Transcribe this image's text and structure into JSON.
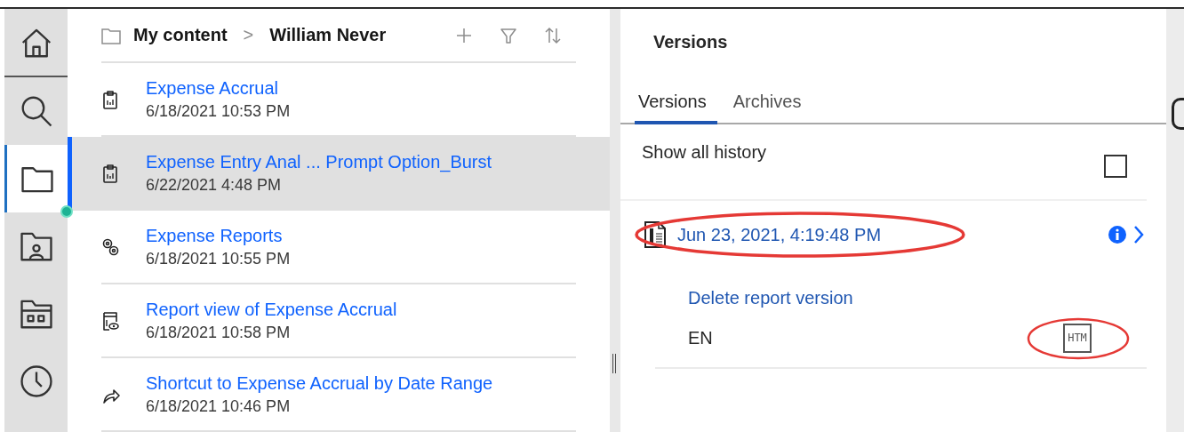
{
  "sidebar": {
    "items": [
      {
        "kind": "home",
        "selected": false
      },
      {
        "kind": "search",
        "selected": false
      },
      {
        "kind": "folder",
        "selected": true,
        "badge": true
      },
      {
        "kind": "team_folder",
        "selected": false
      },
      {
        "kind": "content_folder",
        "selected": false
      },
      {
        "kind": "recent",
        "selected": false
      }
    ]
  },
  "content": {
    "breadcrumb": [
      "My content",
      "William Never"
    ],
    "separator": ">",
    "items": [
      {
        "kind": "report",
        "title": "Expense Accrual",
        "date": "6/18/2021 10:53 PM",
        "selected": false
      },
      {
        "kind": "report",
        "title": "Expense Entry Anal ... Prompt Option_Burst",
        "date": "6/22/2021 4:48 PM",
        "selected": true
      },
      {
        "kind": "job",
        "title": "Expense Reports",
        "date": "6/18/2021 10:55 PM",
        "selected": false
      },
      {
        "kind": "report_view",
        "title": "Report view of Expense Accrual",
        "date": "6/18/2021 10:58 PM",
        "selected": false
      },
      {
        "kind": "shortcut",
        "title": "Shortcut to Expense Accrual by Date Range",
        "date": "6/18/2021 10:46 PM",
        "selected": false
      }
    ]
  },
  "versions_panel": {
    "title": "Versions",
    "tabs": [
      {
        "label": "Versions",
        "selected": true
      },
      {
        "label": "Archives",
        "selected": false
      }
    ],
    "show_all_history": {
      "label": "Show all history",
      "checked": false
    },
    "version": {
      "date": "Jun 23, 2021, 4:19:48 PM",
      "highlighted": true,
      "action": "Delete report version",
      "outputs": [
        {
          "language": "EN",
          "format": "HTM",
          "highlighted": true
        }
      ]
    }
  }
}
